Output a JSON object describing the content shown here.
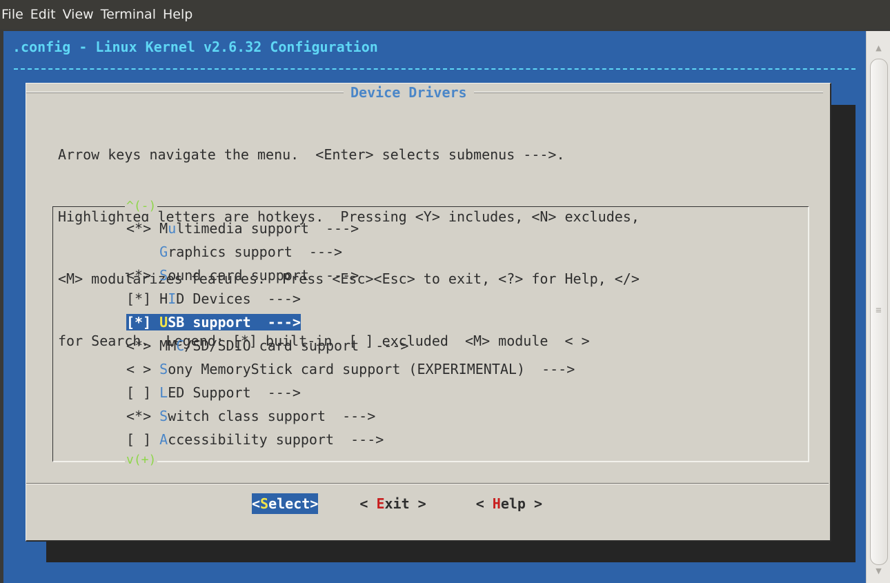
{
  "menubar": {
    "items": [
      "File",
      "Edit",
      "View",
      "Terminal",
      "Help"
    ]
  },
  "terminal": {
    "title": ".config - Linux Kernel v2.6.32 Configuration"
  },
  "dialog": {
    "title": "Device Drivers",
    "instructions": [
      "Arrow keys navigate the menu.  <Enter> selects submenus --->.",
      "Highlighted letters are hotkeys.  Pressing <Y> includes, <N> excludes,",
      "<M> modularizes features.  Press <Esc><Esc> to exit, <?> for Help, </>",
      "for Search.  Legend: [*] built-in  [ ] excluded  <M> module  < >"
    ],
    "scroll_up_indicator": "^(-)",
    "scroll_down_indicator": "v(+)",
    "menu_items": [
      {
        "prefix": "<*> ",
        "pre": "M",
        "hot": "u",
        "post": "ltimedia support  --->"
      },
      {
        "prefix": "    ",
        "pre": "",
        "hot": "G",
        "post": "raphics support  --->"
      },
      {
        "prefix": "<*> ",
        "pre": "",
        "hot": "S",
        "post": "ound card support  --->"
      },
      {
        "prefix": "[*] ",
        "pre": "H",
        "hot": "I",
        "post": "D Devices  --->"
      },
      {
        "prefix": "[*] ",
        "pre": "",
        "hot": "U",
        "post": "SB support  --->",
        "selected": true
      },
      {
        "prefix": "<*> ",
        "pre": "MM",
        "hot": "C",
        "post": "/SD/SDIO card support  --->"
      },
      {
        "prefix": "< > ",
        "pre": "",
        "hot": "S",
        "post": "ony MemoryStick card support (EXPERIMENTAL)  --->"
      },
      {
        "prefix": "[ ] ",
        "pre": "",
        "hot": "L",
        "post": "ED Support  --->"
      },
      {
        "prefix": "<*> ",
        "pre": "",
        "hot": "S",
        "post": "witch class support  --->"
      },
      {
        "prefix": "[ ] ",
        "pre": "",
        "hot": "A",
        "post": "ccessibility support  --->"
      }
    ]
  },
  "buttons": {
    "select": {
      "open": "<",
      "key": "S",
      "rest": "elect>"
    },
    "exit": {
      "open": "< ",
      "key": "E",
      "rest": "xit >"
    },
    "help": {
      "open": "< ",
      "key": "H",
      "rest": "elp >"
    }
  },
  "colors": {
    "terminal_bg": "#2d62a8",
    "dialog_bg": "#d4d1c8",
    "hotkey": "#4a86c8",
    "selection_hotkey": "#f2e44a",
    "button_hotkey": "#c81e1e",
    "scroll_indicator": "#8ed64a",
    "title": "#5fd7f5"
  }
}
